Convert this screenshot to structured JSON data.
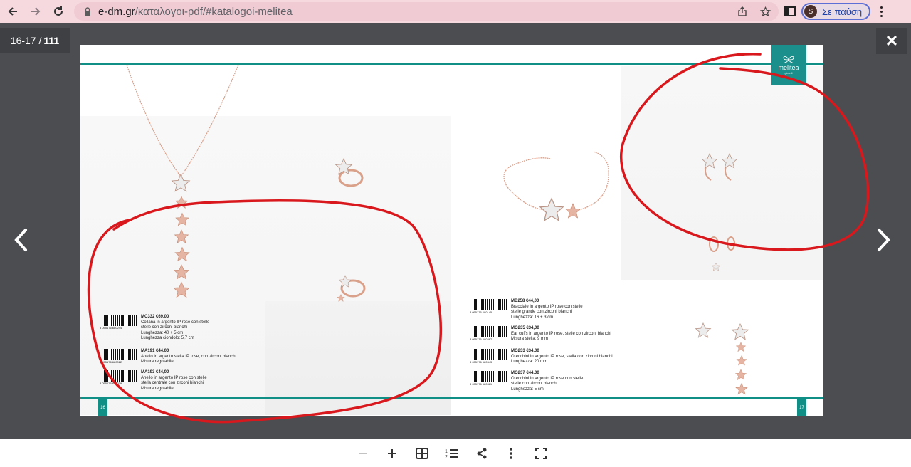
{
  "browser": {
    "back_icon": "arrow-left-icon",
    "forward_icon": "arrow-right-icon",
    "reload_icon": "reload-icon",
    "url_domain": "e-dm.gr",
    "url_path": "/καταλογοι-pdf/#katalogoi-melitea",
    "profile_initial": "S",
    "profile_label": "Σε παύση"
  },
  "viewer": {
    "page_current": "16-17",
    "page_total": "111",
    "close_label": "✕"
  },
  "catalog": {
    "brand": "melitea",
    "brand_sub": "gioielli",
    "left_page_number": "16",
    "right_page_number": "17",
    "products": [
      {
        "code": "MC332 €69,00",
        "barcode": "8 055176 680244",
        "lines": [
          "Collana in argento IP rose con stelle",
          "stelle con zirconi bianchi",
          "Lunghezza: 40 + 5 cm",
          "Lunghezza ciondolo: 5,7 cm"
        ]
      },
      {
        "code": "MA191 €44,00",
        "barcode": "8 055176 680022",
        "lines": [
          "Anello in argento stella IP rose, con zirconi bianchi",
          "Misura regolabile"
        ]
      },
      {
        "code": "MA193 €44,00",
        "barcode": "8 055176 680039",
        "lines": [
          "Anello in argento IP rose con stelle",
          "stella centrale con zirconi bianchi",
          "Misura regolabile"
        ]
      },
      {
        "code": "MB258 €44,00",
        "barcode": "8 055176 680145",
        "lines": [
          "Bracciale in argento IP rose con stelle",
          "stelle grande con zirconi bianchi",
          "Lunghezza: 16 + 3 cm"
        ]
      },
      {
        "code": "MO235 €34,00",
        "barcode": "8 055176 680367",
        "lines": [
          "Ear cuffs in argento IP rose, stelle con zirconi bianchi",
          "Misura stella: 9 mm"
        ]
      },
      {
        "code": "MO233 €34,00",
        "barcode": "8 055176 680343",
        "lines": [
          "Orecchini in argento IP rose, stella con zirconi bianchi",
          "Lunghezza: 20 mm"
        ]
      },
      {
        "code": "MO237 €44,00",
        "barcode": "8 055176 680381",
        "lines": [
          "Orecchini in argento IP rose con stelle",
          "stelle con zirconi bianchi",
          "Lunghezza: 5 cm"
        ]
      }
    ]
  },
  "toolbar": {
    "zoom_out_icon": "minus-icon",
    "zoom_in_icon": "plus-icon",
    "grid_icon": "grid-icon",
    "toc_icon": "numbered-list-icon",
    "share_icon": "share-icon",
    "more_icon": "more-vertical-icon",
    "fullscreen_icon": "fullscreen-icon"
  },
  "colors": {
    "chrome_bg": "#f6d9df",
    "viewer_bg": "#4b4d51",
    "teal": "#0f8f86",
    "annotation_red": "#d8181c",
    "rose_gold": "#d9a08a"
  }
}
